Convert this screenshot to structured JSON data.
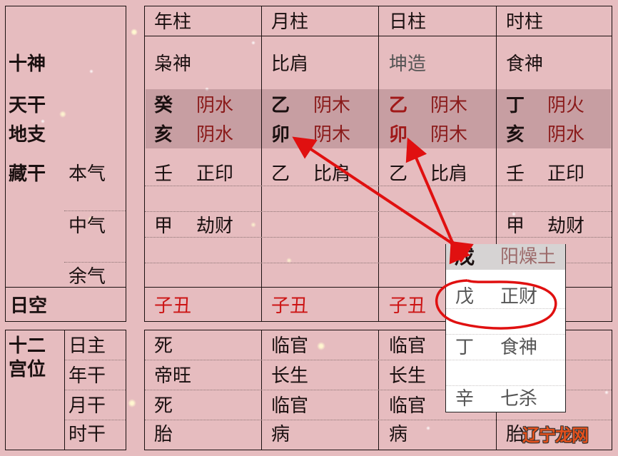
{
  "colors": {
    "background": "#e6bcbf",
    "shaded_row": "#c9a3a6",
    "red_text": "#cc1414",
    "wuxing_text": "#8a1a1a",
    "popup_header": "#d6d3d3",
    "annotation_red": "#e01010",
    "watermark": "#e3501c"
  },
  "left_labels": {
    "shishen": "十神",
    "tiangan": "天干",
    "dizhi": "地支",
    "canggan": "藏干",
    "benqi": "本气",
    "zhongqi": "中气",
    "yuqi": "余气",
    "rikong": "日空",
    "twelve_palace": [
      "十二",
      "宫位"
    ],
    "palace_rows": [
      "日主",
      "年干",
      "月干",
      "时干"
    ]
  },
  "pillars": [
    {
      "header": "年柱",
      "shishen": "枭神",
      "tiangan": {
        "char": "癸",
        "wuxing": "阴水"
      },
      "dizhi": {
        "char": "亥",
        "wuxing": "阴水"
      },
      "canggan": [
        {
          "gan": "壬",
          "god": "正印"
        },
        {
          "gan": "甲",
          "god": "劫财"
        },
        {
          "gan": "",
          "god": ""
        }
      ],
      "rikong": "子丑",
      "palace": [
        "死",
        "帝旺",
        "死",
        "胎"
      ]
    },
    {
      "header": "月柱",
      "shishen": "比肩",
      "tiangan": {
        "char": "乙",
        "wuxing": "阴木"
      },
      "dizhi": {
        "char": "卯",
        "wuxing": "阴木"
      },
      "canggan": [
        {
          "gan": "乙",
          "god": "比肩"
        },
        {
          "gan": "",
          "god": ""
        },
        {
          "gan": "",
          "god": ""
        }
      ],
      "rikong": "子丑",
      "palace": [
        "临官",
        "长生",
        "临官",
        "病"
      ]
    },
    {
      "header": "日柱",
      "shishen": "坤造",
      "tiangan": {
        "char": "乙",
        "wuxing": "阴木"
      },
      "dizhi": {
        "char": "卯",
        "wuxing": "阴木"
      },
      "canggan": [
        {
          "gan": "乙",
          "god": "比肩"
        },
        {
          "gan": "",
          "god": ""
        },
        {
          "gan": "",
          "god": ""
        }
      ],
      "rikong": "子丑",
      "palace": [
        "临官",
        "长生",
        "临官",
        "病"
      ]
    },
    {
      "header": "时柱",
      "shishen": "食神",
      "tiangan": {
        "char": "丁",
        "wuxing": "阴火"
      },
      "dizhi": {
        "char": "亥",
        "wuxing": "阴水"
      },
      "canggan": [
        {
          "gan": "壬",
          "god": "正印"
        },
        {
          "gan": "甲",
          "god": "劫财"
        },
        {
          "gan": "",
          "god": ""
        }
      ],
      "rikong": "",
      "palace": [
        "",
        "",
        "",
        "胎"
      ]
    }
  ],
  "popup": {
    "header_char": "戊",
    "header_wuxing": "阳燥土",
    "rows": [
      {
        "gan": "戊",
        "god": "正财"
      },
      {
        "gan": "丁",
        "god": "食神"
      },
      {
        "gan": "辛",
        "god": "七杀"
      }
    ]
  },
  "watermark": "辽宁龙网"
}
